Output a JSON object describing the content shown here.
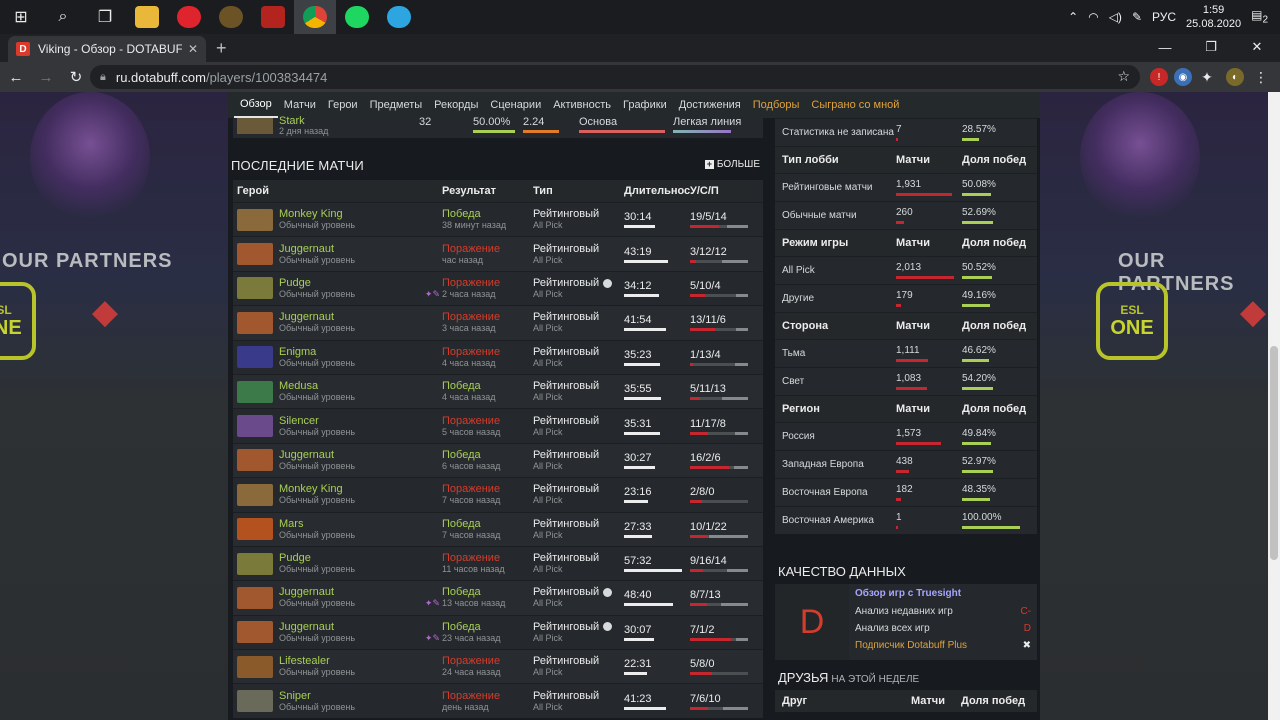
{
  "taskbar": {
    "icons": [
      "windows-start-icon",
      "search-icon",
      "task-view-icon",
      "file-explorer-icon",
      "opera-icon",
      "world-of-warcraft-icon",
      "dota2-icon",
      "chrome-icon",
      "spotify-icon",
      "telegram-icon"
    ],
    "lang": "РУС",
    "time": "1:59",
    "date": "25.08.2020",
    "notifications": "2"
  },
  "browser": {
    "tab_title": "Viking - Обзор - DOTABUFF - Do",
    "url_host": "ru.dotabuff.com",
    "url_path": "/players/1003834474"
  },
  "nav": {
    "items": [
      {
        "label": "Обзор",
        "state": "active"
      },
      {
        "label": "Матчи",
        "state": ""
      },
      {
        "label": "Герои",
        "state": ""
      },
      {
        "label": "Предметы",
        "state": ""
      },
      {
        "label": "Рекорды",
        "state": ""
      },
      {
        "label": "Сценарии",
        "state": ""
      },
      {
        "label": "Активность",
        "state": ""
      },
      {
        "label": "Графики",
        "state": ""
      },
      {
        "label": "Достижения",
        "state": ""
      },
      {
        "label": "Подборы",
        "state": "accent"
      },
      {
        "label": "Сыграно со мной",
        "state": "accent"
      }
    ]
  },
  "sidebar_ads": {
    "partners_text": "OUR PARTNERS",
    "esl_top": "ESL",
    "esl_bottom": "ONE"
  },
  "prev_row": {
    "hero": "Stark",
    "time": "2 дня назад",
    "matches": "32",
    "winrate": "50.00%",
    "kda": "2.24",
    "role": "Основа",
    "lane": "Легкая линия"
  },
  "recent": {
    "title": "ПОСЛЕДНИЕ МАТЧИ",
    "more": "БОЛЬШЕ",
    "headers": {
      "hero": "Герой",
      "result": "Результат",
      "type": "Тип",
      "duration": "Длительность",
      "kda": "У/С/П"
    },
    "matches": [
      {
        "hero": "Monkey King",
        "skill": "Обычный уровень",
        "result": "Победа",
        "win": true,
        "time": "38 минут назад",
        "type": "Рейтинговый",
        "mode": "All Pick",
        "party": false,
        "items": false,
        "duration": "30:14",
        "dur_frac": 0.53,
        "kda": "19/5/14",
        "k": 19,
        "d": 5,
        "a": 14
      },
      {
        "hero": "Juggernaut",
        "skill": "Обычный уровень",
        "result": "Поражение",
        "win": false,
        "time": "час назад",
        "type": "Рейтинговый",
        "mode": "All Pick",
        "party": false,
        "items": false,
        "duration": "43:19",
        "dur_frac": 0.76,
        "kda": "3/12/12",
        "k": 3,
        "d": 12,
        "a": 12
      },
      {
        "hero": "Pudge",
        "skill": "Обычный уровень",
        "result": "Поражение",
        "win": false,
        "time": "2 часа назад",
        "type": "Рейтинговый",
        "mode": "All Pick",
        "party": true,
        "items": true,
        "duration": "34:12",
        "dur_frac": 0.6,
        "kda": "5/10/4",
        "k": 5,
        "d": 10,
        "a": 4
      },
      {
        "hero": "Juggernaut",
        "skill": "Обычный уровень",
        "result": "Поражение",
        "win": false,
        "time": "3 часа назад",
        "type": "Рейтинговый",
        "mode": "All Pick",
        "party": false,
        "items": false,
        "duration": "41:54",
        "dur_frac": 0.73,
        "kda": "13/11/6",
        "k": 13,
        "d": 11,
        "a": 6
      },
      {
        "hero": "Enigma",
        "skill": "Обычный уровень",
        "result": "Поражение",
        "win": false,
        "time": "4 часа назад",
        "type": "Рейтинговый",
        "mode": "All Pick",
        "party": false,
        "items": false,
        "duration": "35:23",
        "dur_frac": 0.62,
        "kda": "1/13/4",
        "k": 1,
        "d": 13,
        "a": 4
      },
      {
        "hero": "Medusa",
        "skill": "Обычный уровень",
        "result": "Победа",
        "win": true,
        "time": "4 часа назад",
        "type": "Рейтинговый",
        "mode": "All Pick",
        "party": false,
        "items": false,
        "duration": "35:55",
        "dur_frac": 0.63,
        "kda": "5/11/13",
        "k": 5,
        "d": 11,
        "a": 13
      },
      {
        "hero": "Silencer",
        "skill": "Обычный уровень",
        "result": "Поражение",
        "win": false,
        "time": "5 часов назад",
        "type": "Рейтинговый",
        "mode": "All Pick",
        "party": false,
        "items": false,
        "duration": "35:31",
        "dur_frac": 0.62,
        "kda": "11/17/8",
        "k": 11,
        "d": 17,
        "a": 8
      },
      {
        "hero": "Juggernaut",
        "skill": "Обычный уровень",
        "result": "Победа",
        "win": true,
        "time": "6 часов назад",
        "type": "Рейтинговый",
        "mode": "All Pick",
        "party": false,
        "items": false,
        "duration": "30:27",
        "dur_frac": 0.53,
        "kda": "16/2/6",
        "k": 16,
        "d": 2,
        "a": 6
      },
      {
        "hero": "Monkey King",
        "skill": "Обычный уровень",
        "result": "Поражение",
        "win": false,
        "time": "7 часов назад",
        "type": "Рейтинговый",
        "mode": "All Pick",
        "party": false,
        "items": false,
        "duration": "23:16",
        "dur_frac": 0.41,
        "kda": "2/8/0",
        "k": 2,
        "d": 8,
        "a": 0
      },
      {
        "hero": "Mars",
        "skill": "Обычный уровень",
        "result": "Победа",
        "win": true,
        "time": "7 часов назад",
        "type": "Рейтинговый",
        "mode": "All Pick",
        "party": false,
        "items": false,
        "duration": "27:33",
        "dur_frac": 0.48,
        "kda": "10/1/22",
        "k": 10,
        "d": 1,
        "a": 22
      },
      {
        "hero": "Pudge",
        "skill": "Обычный уровень",
        "result": "Поражение",
        "win": false,
        "time": "11 часов назад",
        "type": "Рейтинговый",
        "mode": "All Pick",
        "party": false,
        "items": false,
        "duration": "57:32",
        "dur_frac": 1.0,
        "kda": "9/16/14",
        "k": 9,
        "d": 16,
        "a": 14
      },
      {
        "hero": "Juggernaut",
        "skill": "Обычный уровень",
        "result": "Победа",
        "win": true,
        "time": "13 часов назад",
        "type": "Рейтинговый",
        "mode": "All Pick",
        "party": true,
        "items": true,
        "duration": "48:40",
        "dur_frac": 0.85,
        "kda": "8/7/13",
        "k": 8,
        "d": 7,
        "a": 13
      },
      {
        "hero": "Juggernaut",
        "skill": "Обычный уровень",
        "result": "Победа",
        "win": true,
        "time": "23 часа назад",
        "type": "Рейтинговый",
        "mode": "All Pick",
        "party": true,
        "items": true,
        "duration": "30:07",
        "dur_frac": 0.52,
        "kda": "7/1/2",
        "k": 7,
        "d": 1,
        "a": 2
      },
      {
        "hero": "Lifestealer",
        "skill": "Обычный уровень",
        "result": "Поражение",
        "win": false,
        "time": "24 часа назад",
        "type": "Рейтинговый",
        "mode": "All Pick",
        "party": false,
        "items": false,
        "duration": "22:31",
        "dur_frac": 0.39,
        "kda": "5/8/0",
        "k": 5,
        "d": 8,
        "a": 0
      },
      {
        "hero": "Sniper",
        "skill": "Обычный уровень",
        "result": "Поражение",
        "win": false,
        "time": "день назад",
        "type": "Рейтинговый",
        "mode": "All Pick",
        "party": false,
        "items": false,
        "duration": "41:23",
        "dur_frac": 0.72,
        "kda": "7/6/10",
        "k": 7,
        "d": 6,
        "a": 10
      }
    ]
  },
  "stats": {
    "rows": [
      {
        "kind": "row",
        "name": "Статистика не записана",
        "matches": "7",
        "m_frac": 0.01,
        "winrate": "28.57%",
        "w_frac": 0.29
      },
      {
        "kind": "head",
        "name": "Тип лобби",
        "matches": "Матчи",
        "winrate": "Доля побед"
      },
      {
        "kind": "row",
        "name": "Рейтинговые матчи",
        "matches": "1,931",
        "m_frac": 0.96,
        "winrate": "50.08%",
        "w_frac": 0.5
      },
      {
        "kind": "row",
        "name": "Обычные матчи",
        "matches": "260",
        "m_frac": 0.13,
        "winrate": "52.69%",
        "w_frac": 0.53
      },
      {
        "kind": "head",
        "name": "Режим игры",
        "matches": "Матчи",
        "winrate": "Доля побед"
      },
      {
        "kind": "row",
        "name": "All Pick",
        "matches": "2,013",
        "m_frac": 1.0,
        "winrate": "50.52%",
        "w_frac": 0.51
      },
      {
        "kind": "row",
        "name": "Другие",
        "matches": "179",
        "m_frac": 0.09,
        "winrate": "49.16%",
        "w_frac": 0.49
      },
      {
        "kind": "head",
        "name": "Сторона",
        "matches": "Матчи",
        "winrate": "Доля побед"
      },
      {
        "kind": "row",
        "name": "Тьма",
        "matches": "1,111",
        "m_frac": 0.55,
        "winrate": "46.62%",
        "w_frac": 0.47
      },
      {
        "kind": "row",
        "name": "Свет",
        "matches": "1,083",
        "m_frac": 0.54,
        "winrate": "54.20%",
        "w_frac": 0.54
      },
      {
        "kind": "head",
        "name": "Регион",
        "matches": "Матчи",
        "winrate": "Доля побед"
      },
      {
        "kind": "row",
        "name": "Россия",
        "matches": "1,573",
        "m_frac": 0.78,
        "winrate": "49.84%",
        "w_frac": 0.5
      },
      {
        "kind": "row",
        "name": "Западная Европа",
        "matches": "438",
        "m_frac": 0.22,
        "winrate": "52.97%",
        "w_frac": 0.53
      },
      {
        "kind": "row",
        "name": "Восточная Европа",
        "matches": "182",
        "m_frac": 0.09,
        "winrate": "48.35%",
        "w_frac": 0.48
      },
      {
        "kind": "row",
        "name": "Восточная Америка",
        "matches": "1",
        "m_frac": 0.0,
        "winrate": "100.00%",
        "w_frac": 1.0
      }
    ]
  },
  "data_quality": {
    "title": "КАЧЕСТВО ДАННЫХ",
    "grade": "D",
    "heading": "Обзор игр с Truesight",
    "line1": "Анализ недавних игр",
    "line1_grade": "C-",
    "line2": "Анализ всех игр",
    "line2_grade": "D",
    "line3": "Подписчик Dotabuff Plus",
    "line3_mark": "✖"
  },
  "friends": {
    "title": "ДРУЗЬЯ",
    "subtitle": "НА ЭТОЙ НЕДЕЛЕ",
    "col_friend": "Друг",
    "col_matches": "Матчи",
    "col_winrate": "Доля побед"
  },
  "colors": {
    "win": "#a9cf54",
    "loss": "#d43c2b",
    "bar_red": "#c6262e",
    "bar_green": "#a9cf54",
    "bar_grey": "#868a8c",
    "bar_white": "#ececec"
  }
}
